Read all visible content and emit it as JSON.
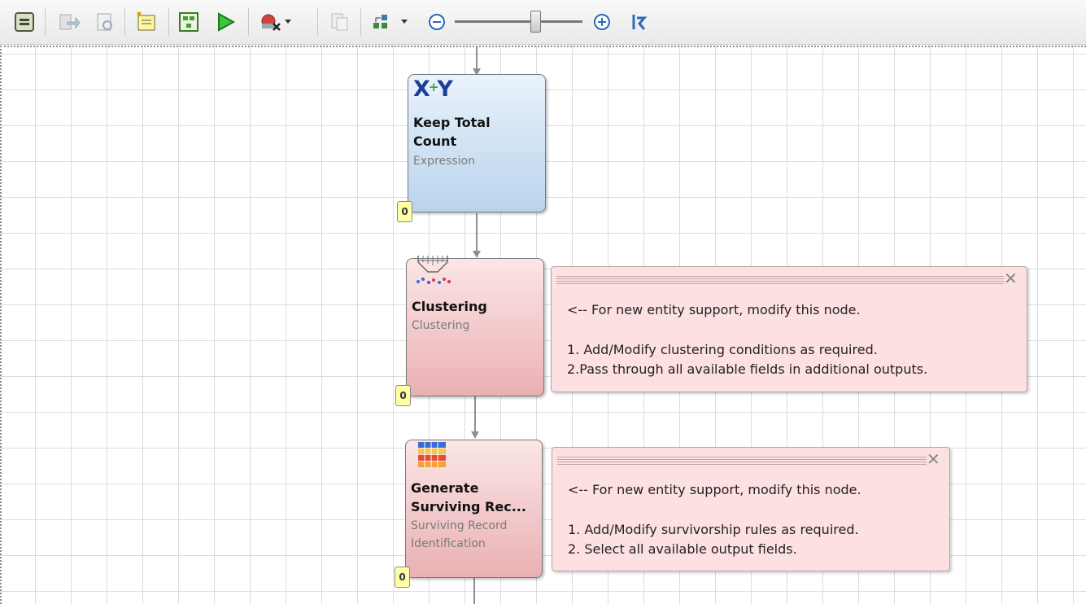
{
  "toolbar": {
    "buttons": [
      {
        "name": "collapse-panel-icon"
      },
      {
        "name": "export-icon"
      },
      {
        "name": "preview-icon"
      },
      {
        "name": "new-note-icon"
      },
      {
        "name": "generate-icon"
      },
      {
        "name": "run-icon"
      },
      {
        "name": "clear-icon"
      },
      {
        "name": "copy-icon"
      },
      {
        "name": "layout-icon"
      },
      {
        "name": "zoom-out-icon"
      },
      {
        "name": "zoom-in-icon"
      },
      {
        "name": "reset-zoom-icon"
      }
    ],
    "zoom_level": 0.65
  },
  "nodes": [
    {
      "title_line1": "Keep Total",
      "title_line2": "Count",
      "subtitle": "Expression",
      "icon": "expression-xy-icon",
      "badge": "0",
      "color": "#c6dbef"
    },
    {
      "title_line1": "Clustering",
      "subtitle": "Clustering",
      "icon": "clustering-icon",
      "badge": "0",
      "color": "#f2c4c6"
    },
    {
      "title_line1": "Generate",
      "title_line2": "Surviving Rec...",
      "subtitle_line1": "Surviving Record",
      "subtitle_line2": "Identification",
      "icon": "table-grid-icon",
      "badge": "0",
      "color": "#f2c4c6"
    }
  ],
  "notes": [
    {
      "line1": "<-- For new entity support, modify this node.",
      "line2": "1. Add/Modify clustering conditions as required.",
      "line3": "2.Pass through all available fields in additional outputs."
    },
    {
      "line1": "<-- For new entity support, modify this node.",
      "line2": "1. Add/Modify survivorship rules as required.",
      "line3": "2. Select all available output fields."
    }
  ]
}
